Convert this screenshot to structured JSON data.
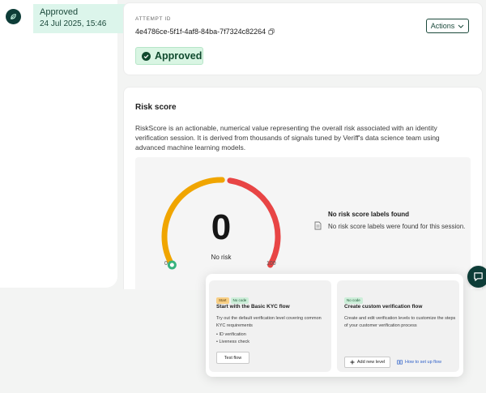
{
  "timeline": {
    "status": "Approved",
    "date": "24 Jul 2025, 15:46"
  },
  "attempt": {
    "label": "ATTEMPT ID",
    "id": "4e4786ce-5f1f-4af8-84ba-7f7324c82264",
    "actions_label": "Actions",
    "status_badge": "Approved"
  },
  "risk": {
    "title": "Risk score",
    "description": "RiskScore is an actionable, numerical value representing the overall risk associated with an identity verification session. It is derived from thousands of signals tuned by Veriff's data science team using advanced machine learning models.",
    "gauge": {
      "value": "0",
      "sublabel": "No risk",
      "min_label": "0",
      "max_label": "100",
      "score": 0,
      "colors": {
        "low": "#f0a500",
        "high": "#e84545",
        "indicator": "#36b37e"
      }
    },
    "labels": {
      "title": "No risk score labels found",
      "text": "No risk score labels were found for this session."
    }
  },
  "onboarding": {
    "kyc_card": {
      "tags": [
        "Start",
        "No code"
      ],
      "title": "Start with the Basic KYC flow",
      "description": "Try out the default verification level covering common KYC requirements",
      "items": [
        "• ID verification",
        "• Liveness check"
      ],
      "button": "Test flow"
    },
    "custom_card": {
      "tags": [
        "No code"
      ],
      "title": "Create custom verification flow",
      "description": "Create and edit verification levels to customize the steps of your customer verification process",
      "add_button": "Add new level",
      "link": "How to set up flow"
    }
  },
  "icons": {
    "avatar": "leaf-icon",
    "copy": "copy-icon",
    "actions_chevron": "chevron-down-icon",
    "badge": "check-circle-icon",
    "labels": "document-icon",
    "chat": "chat-bubble-icon",
    "add": "plus-icon",
    "link": "book-icon"
  },
  "colors": {
    "brand_dark": "#0e3d38",
    "approved_bg": "#dcf5eb",
    "approved_text": "#104a2e",
    "link": "#2d5fc8"
  }
}
